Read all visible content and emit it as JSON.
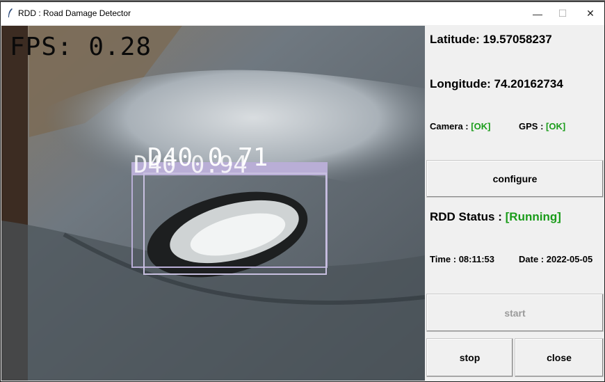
{
  "window": {
    "title": "RDD : Road Damage Detector",
    "controls": {
      "minimize": "—",
      "maximize": "☐",
      "close": "✕"
    }
  },
  "video": {
    "fps_text": "FPS: 0.28",
    "detection_label": "D40 0.71",
    "detection_label_secondary": "D40 0.94",
    "box_color": "#b9aed6"
  },
  "panel": {
    "latitude": "Latitude: 19.57058237",
    "longitude": "Longitude: 74.20162734",
    "camera_label": "Camera :",
    "camera_value": "[OK]",
    "gps_label": "GPS :",
    "gps_value": "[OK]",
    "configure_label": "configure",
    "rdd_status_label": "RDD Status :",
    "rdd_status_value": "[Running]",
    "time_label": "Time :",
    "time_value": "08:11:53",
    "date_label": "Date :",
    "date_value": "2022-05-05",
    "start_label": "start",
    "stop_label": "stop",
    "close_label": "close"
  },
  "colors": {
    "ok_green": "#1a9c1a",
    "disabled_gray": "#9a9a9a"
  }
}
